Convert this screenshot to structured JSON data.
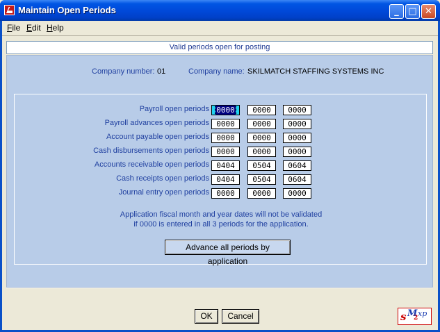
{
  "window": {
    "title": "Maintain Open Periods",
    "minimize_glyph": "_",
    "maximize_glyph": "□",
    "close_glyph": "✕"
  },
  "menu": [
    {
      "label": "File"
    },
    {
      "label": "Edit"
    },
    {
      "label": "Help"
    }
  ],
  "header": {
    "text": "Valid periods open for posting"
  },
  "company": {
    "number_label": "Company number:",
    "number_value": "01",
    "name_label": "Company name:",
    "name_value": "SKILMATCH STAFFING SYSTEMS INC"
  },
  "periods": [
    {
      "label": "Payroll open periods",
      "values": [
        "0000",
        "0000",
        "0000"
      ]
    },
    {
      "label": "Payroll advances open periods",
      "values": [
        "0000",
        "0000",
        "0000"
      ]
    },
    {
      "label": "Account payable open periods",
      "values": [
        "0000",
        "0000",
        "0000"
      ]
    },
    {
      "label": "Cash disbursements open periods",
      "values": [
        "0000",
        "0000",
        "0000"
      ]
    },
    {
      "label": "Accounts receivable open periods",
      "values": [
        "0404",
        "0504",
        "0604"
      ]
    },
    {
      "label": "Cash receipts open periods",
      "values": [
        "0404",
        "0504",
        "0604"
      ]
    },
    {
      "label": "Journal entry open periods",
      "values": [
        "0000",
        "0000",
        "0000"
      ]
    }
  ],
  "note": {
    "line1": "Application fiscal month and year dates will not be validated",
    "line2": "if 0000 is entered in all 3 periods for the application."
  },
  "buttons": {
    "advance": "Advance all periods by application",
    "ok": "OK",
    "cancel": "Cancel"
  },
  "logo": {
    "s": "s",
    "m": "M",
    "two": "2",
    "xp": "xp"
  },
  "colors": {
    "panel_bg": "#b8cce8",
    "label_text": "#2040a0",
    "focus_field": "#22d3f0",
    "titlebar": "#0055e3"
  }
}
